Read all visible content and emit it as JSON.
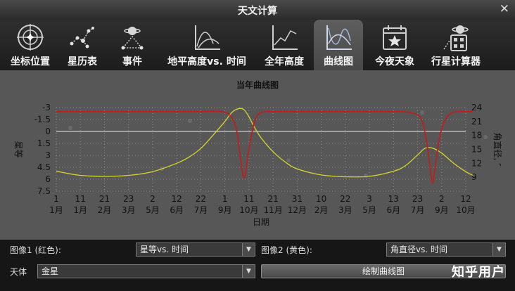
{
  "window": {
    "title": "天文计算"
  },
  "tabs": [
    {
      "label": "坐标位置",
      "icon": "crosshair-star-icon"
    },
    {
      "label": "星历表",
      "icon": "constellation-icon"
    },
    {
      "label": "事件",
      "icon": "planet-event-icon"
    },
    {
      "label": "地平高度vs. 时间",
      "icon": "altitude-chart-icon"
    },
    {
      "label": "全年高度",
      "icon": "yearly-altitude-icon"
    },
    {
      "label": "曲线图",
      "icon": "graph-icon"
    },
    {
      "label": "今夜天象",
      "icon": "calendar-star-icon"
    },
    {
      "label": "行星计算器",
      "icon": "planet-calculator-icon"
    }
  ],
  "active_tab": 5,
  "chart_data": {
    "type": "line",
    "title": "当年曲线图",
    "xlabel": "日期",
    "ylabel_left": "星等",
    "ylabel_right": "角直径, ″",
    "x_ticks": [
      [
        "1",
        "1月"
      ],
      [
        "11",
        "1月"
      ],
      [
        "21",
        "2月"
      ],
      [
        "23",
        "3月"
      ],
      [
        "2",
        "5月"
      ],
      [
        "12",
        "6月"
      ],
      [
        "22",
        "7月"
      ],
      [
        "1",
        "9月"
      ],
      [
        "11",
        "10月"
      ],
      [
        "21",
        "11月"
      ],
      [
        "31",
        "12月"
      ],
      [
        "10",
        "2月"
      ],
      [
        "22",
        "3月"
      ],
      [
        "3",
        "5月"
      ],
      [
        "13",
        "6月"
      ],
      [
        "23",
        "7月"
      ],
      [
        "2",
        "9月"
      ],
      [
        "12",
        "10月"
      ]
    ],
    "y_left_ticks": [
      "-3",
      "-1.5",
      "0",
      "1.5",
      "3",
      "4.5",
      "6",
      "7.5"
    ],
    "y_left_range": [
      -3,
      7.5
    ],
    "y_right_ticks": [
      "24",
      "21",
      "18",
      "15",
      "12",
      "9"
    ],
    "y_right_range": [
      6,
      24
    ],
    "grid": true,
    "series": [
      {
        "name": "图像1 (红色)",
        "quantity": "星等vs. 时间",
        "color": "#c81a1a",
        "x_index": [
          0,
          1,
          2,
          3,
          4,
          5,
          6,
          6.5,
          7,
          7.3,
          7.5,
          7.65,
          7.8,
          7.95,
          8.1,
          8.3,
          8.6,
          9,
          9.5,
          10,
          11,
          12,
          13,
          14,
          14.5,
          15,
          15.2,
          15.35,
          15.5,
          15.62,
          15.75,
          15.9,
          16.1,
          16.4,
          16.8,
          17.3
        ],
        "values": [
          -2.5,
          -2.5,
          -2.5,
          -2.5,
          -2.5,
          -2.5,
          -2.5,
          -2.55,
          -2.4,
          -1.7,
          0,
          3.5,
          5.8,
          3.2,
          0.5,
          -1.8,
          -2.45,
          -2.5,
          -2.5,
          -2.5,
          -2.5,
          -2.5,
          -2.5,
          -2.5,
          -2.45,
          -2.1,
          -1.2,
          0.8,
          4,
          6.5,
          4,
          1,
          -1.2,
          -2.3,
          -2.5,
          -2.5
        ]
      },
      {
        "name": "图像2 (黄色)",
        "quantity": "角直径vs. 时间",
        "color": "#d6d62c",
        "x_index": [
          0,
          1,
          2,
          3,
          4,
          5,
          5.5,
          6,
          6.5,
          7,
          7.3,
          7.6,
          7.8,
          8,
          8.2,
          8.5,
          9,
          9.5,
          10,
          11,
          12,
          13,
          14,
          14.5,
          15,
          15.3,
          15.6,
          16,
          16.5,
          17,
          17.3
        ],
        "values": [
          10.3,
          9.4,
          9.2,
          9.4,
          10.2,
          12,
          13.3,
          15.2,
          18,
          21,
          23,
          23.8,
          23.5,
          22,
          20,
          17.5,
          14.5,
          12.3,
          10.8,
          9.5,
          9.1,
          9.2,
          10.3,
          11.5,
          13.8,
          15.2,
          15.3,
          14.2,
          12,
          10.2,
          9.4
        ]
      }
    ]
  },
  "controls": {
    "image1_label": "图像1 (红色):",
    "image1_value": "星等vs. 时间",
    "image2_label": "图像2 (黄色):",
    "image2_value": "角直径vs. 时间",
    "body_label": "天体",
    "body_value": "金星",
    "plot_button": "绘制曲线图"
  },
  "watermark": "知乎用户",
  "colors": {
    "panel": "#575757",
    "red_curve": "#c81a1a",
    "yellow_curve": "#d6d62c",
    "accent_tab": "#5a5a5a"
  }
}
